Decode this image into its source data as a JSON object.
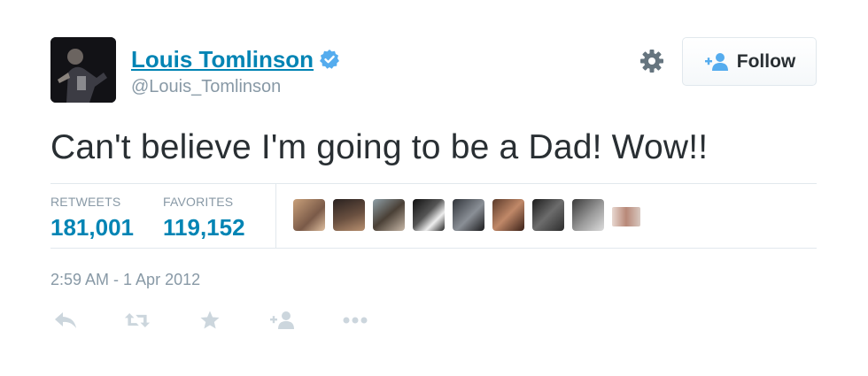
{
  "user": {
    "name": "Louis Tomlinson",
    "screen_name": "@Louis_Tomlinson",
    "verified": true,
    "avatar_icon": "profile-photo"
  },
  "header": {
    "settings_icon": "gear-icon",
    "follow_label": "Follow",
    "follow_icon": "add-user-icon"
  },
  "tweet": {
    "text": "Can't believe I'm going to be a Dad! Wow!!"
  },
  "stats": {
    "retweets_label": "RETWEETS",
    "retweets_value": "181,001",
    "favorites_label": "FAVORITES",
    "favorites_value": "119,152"
  },
  "favoriters_count_shown": 9,
  "timestamp": "2:59 AM - 1 Apr 2012",
  "actions": [
    "reply-icon",
    "retweet-icon",
    "favorite-icon",
    "follow-icon",
    "more-icon"
  ],
  "colors": {
    "link": "#0084b4",
    "muted": "#8899a6",
    "text": "#292f33",
    "verified": "#55acee",
    "border": "#e1e8ed"
  }
}
